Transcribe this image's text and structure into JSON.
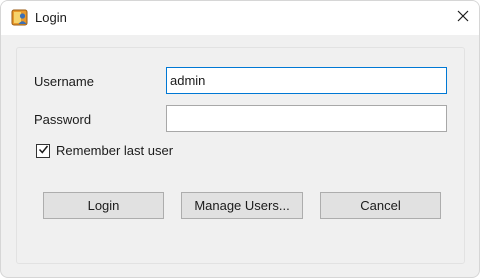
{
  "window": {
    "title": "Login",
    "app_icon": "login-app-icon",
    "close_icon": "close-icon"
  },
  "form": {
    "username_label": "Username",
    "username_value": "admin",
    "password_label": "Password",
    "password_value": "",
    "remember_label": "Remember last user",
    "remember_checked": true
  },
  "buttons": {
    "login": "Login",
    "manage_users": "Manage Users...",
    "cancel": "Cancel"
  },
  "colors": {
    "focus_border": "#0078d4",
    "button_face": "#e1e1e1",
    "dialog_background": "#f0f0f0"
  }
}
